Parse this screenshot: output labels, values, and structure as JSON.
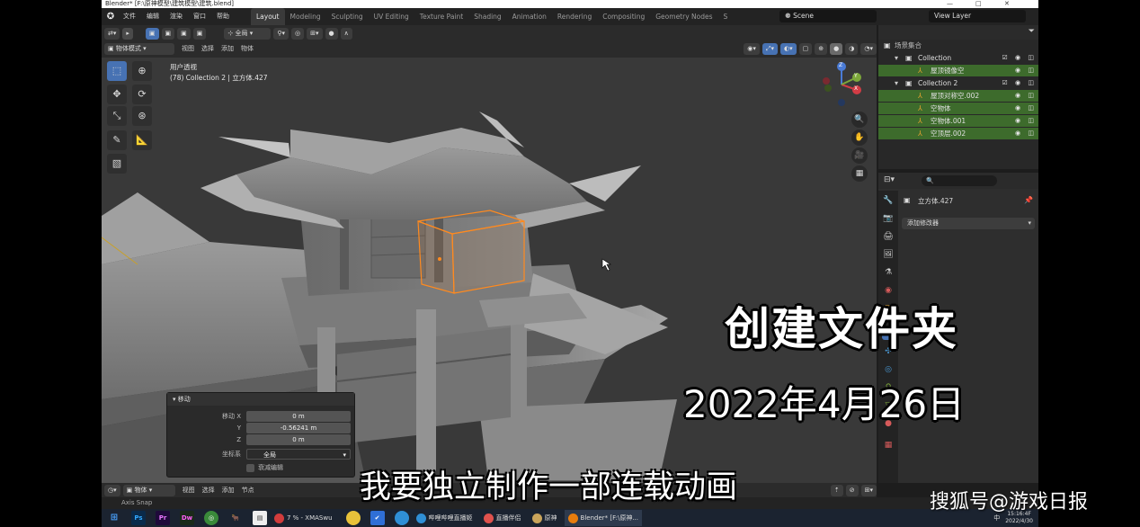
{
  "window": {
    "title": "Blender* [F:\\原神模型\\建筑模型\\建筑.blend]",
    "controls": [
      "—",
      "□",
      "✕"
    ]
  },
  "menu": {
    "items": [
      "文件",
      "编辑",
      "渲染",
      "窗口",
      "帮助"
    ],
    "workspace_tabs": [
      "Layout",
      "Modeling",
      "Sculpting",
      "UV Editing",
      "Texture Paint",
      "Shading",
      "Animation",
      "Rendering",
      "Compositing",
      "Geometry Nodes",
      "S"
    ],
    "active_tab": "Layout",
    "scene": "Scene",
    "view_layer": "View Layer"
  },
  "viewport": {
    "header": {
      "mode": "物体模式",
      "menus": [
        "视图",
        "选择",
        "添加",
        "物体"
      ],
      "transform_orientation": "全局"
    },
    "overlay_view": "用户透视",
    "overlay_collection": "(78) Collection 2 | 立方体.427",
    "gizmo_axes": {
      "x": "X",
      "y": "Y",
      "z": "Z"
    }
  },
  "redo_panel": {
    "title": "移动",
    "fields": [
      {
        "label": "移动 X",
        "value": "0 m"
      },
      {
        "label": "Y",
        "value": "-0.56241 m"
      },
      {
        "label": "Z",
        "value": "0 m"
      }
    ],
    "orientation_label": "坐标系",
    "orientation_value": "全局",
    "proportional_label": "衰减编辑"
  },
  "timeline_bar": {
    "mode": "物体",
    "menus": [
      "视图",
      "选择",
      "添加",
      "节点"
    ]
  },
  "status_bar": {
    "text": "Axis Snap"
  },
  "outliner": {
    "root": "场景集合",
    "rows": [
      {
        "label": "Collection",
        "indent": 1,
        "type": "collection",
        "highlight": false
      },
      {
        "label": "屋顶镜像空",
        "indent": 2,
        "type": "empty",
        "highlight": true
      },
      {
        "label": "Collection 2",
        "indent": 1,
        "type": "collection",
        "highlight": false
      },
      {
        "label": "屋顶对称空.002",
        "indent": 2,
        "type": "empty",
        "highlight": true
      },
      {
        "label": "空物体",
        "indent": 2,
        "type": "empty",
        "highlight": true
      },
      {
        "label": "空物体.001",
        "indent": 2,
        "type": "empty",
        "highlight": true
      },
      {
        "label": "空顶层.002",
        "indent": 2,
        "type": "empty",
        "highlight": true
      }
    ]
  },
  "properties": {
    "object_name": "立方体.427",
    "add_modifier": "添加修改器"
  },
  "taskbar": {
    "apps": [
      "Ps",
      "Pr",
      "Dw"
    ],
    "tasks": [
      {
        "label": "7 % - XMASwu",
        "color": "#d23c3c"
      },
      {
        "label": "哔哩哔哩直播姬",
        "color": "#2f8fd6"
      },
      {
        "label": "直播伴侣",
        "color": "#e0524d"
      },
      {
        "label": "原神",
        "color": "#c9a45b"
      },
      {
        "label": "Blender* [F:\\原神...",
        "color": "#e87d0d"
      }
    ],
    "ime": "中",
    "time": "15:16:4F",
    "date": "2022/4/30"
  },
  "captions": {
    "title": "创建文件夹",
    "date": "2022年4月26日",
    "subtitle": "我要独立制作一部连载动画",
    "watermark": "搜狐号@游戏日报"
  },
  "colors": {
    "accent": "#4772b3",
    "selection_orange": "#ff8a1f",
    "outliner_green": "#3d6b2c"
  }
}
